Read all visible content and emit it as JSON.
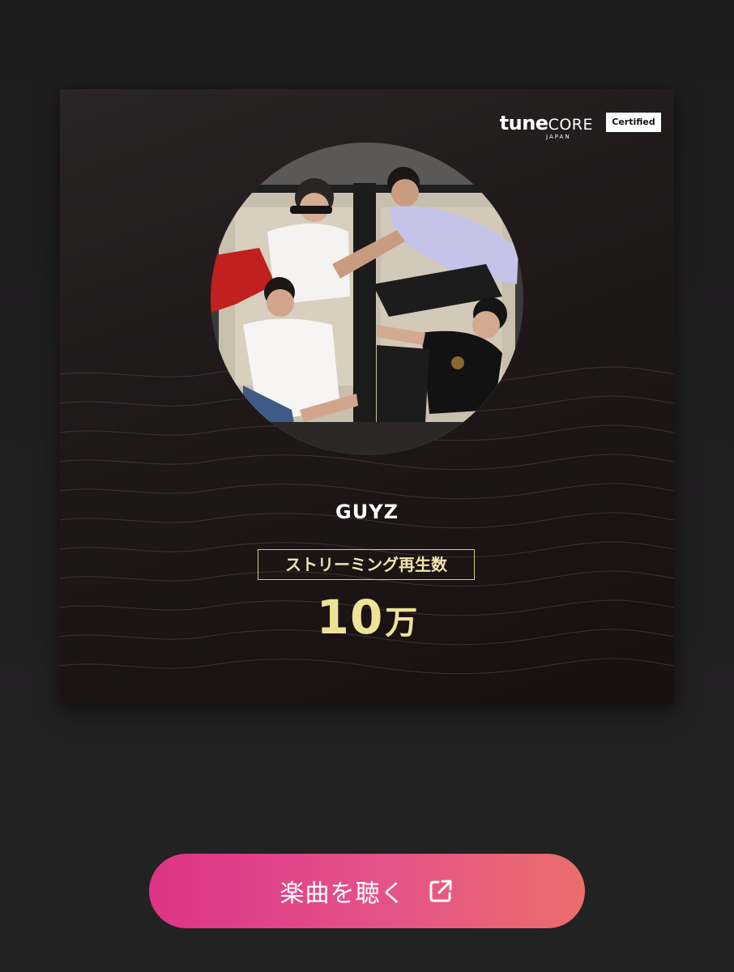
{
  "brand": {
    "name_bold": "tune",
    "name_light": "CORE",
    "region": "JAPAN",
    "badge": "Certified"
  },
  "artist": {
    "name": "GUYZ",
    "photo_icon": "artist-photo"
  },
  "metric": {
    "label": "ストリーミング再生数",
    "value_number": "10",
    "value_unit": "万"
  },
  "action": {
    "label": "楽曲を聴く",
    "icon": "external-link-icon"
  },
  "colors": {
    "background": "#222122",
    "card_top": "#2a2526",
    "card_bottom": "#1a0f10",
    "gold": "#ece396",
    "button_start": "#dd3486",
    "button_end": "#ea6e6c"
  }
}
